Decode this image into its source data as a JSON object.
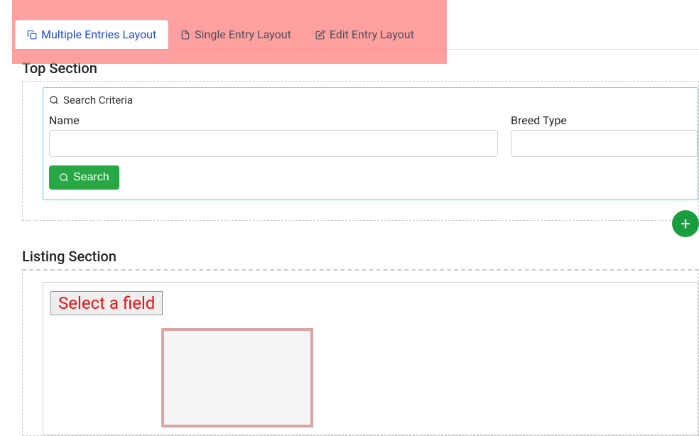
{
  "tabs": [
    {
      "label": "Multiple Entries Layout",
      "active": true,
      "icon": "copy-icon"
    },
    {
      "label": "Single Entry Layout",
      "active": false,
      "icon": "file-icon"
    },
    {
      "label": "Edit Entry Layout",
      "active": false,
      "icon": "edit-icon"
    }
  ],
  "topSection": {
    "title": "Top Section",
    "searchCriteria": {
      "label": "Search Criteria",
      "fields": [
        {
          "label": "Name",
          "value": ""
        },
        {
          "label": "Breed Type",
          "value": ""
        }
      ],
      "searchButton": "Search"
    }
  },
  "fab": {
    "addLabel": "+"
  },
  "listingSection": {
    "title": "Listing Section",
    "placeholder": "Select a field"
  }
}
